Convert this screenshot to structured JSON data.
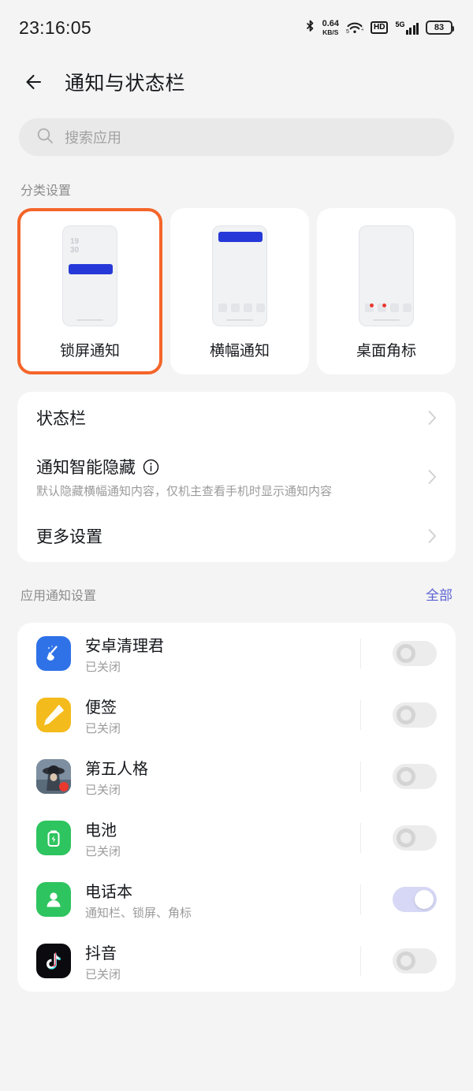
{
  "statusbar": {
    "clock": "23:16:05",
    "bluetooth_icon": "bluetooth-icon",
    "netspeed_value": "0.64",
    "netspeed_unit": "KB/S",
    "wifi_icon": "wifi-icon",
    "hd_label": "HD",
    "network_label": "5G",
    "signal_icon": "signal-bars-icon",
    "battery_level": "83"
  },
  "header": {
    "back_icon": "back-arrow-icon",
    "title": "通知与状态栏"
  },
  "search": {
    "icon": "search-icon",
    "placeholder": "搜索应用"
  },
  "category": {
    "label": "分类设置",
    "selected_color": "#f4652a",
    "cards": [
      {
        "label": "锁屏通知",
        "preview": "lockscreen-preview",
        "time_line1": "19",
        "time_line2": "30",
        "selected": true
      },
      {
        "label": "横幅通知",
        "preview": "banner-preview",
        "selected": false
      },
      {
        "label": "桌面角标",
        "preview": "badge-preview",
        "selected": false
      }
    ]
  },
  "settings_group": {
    "rows": [
      {
        "title": "状态栏",
        "sub": "",
        "has_info": false,
        "chevron": "chevron-right-icon"
      },
      {
        "title": "通知智能隐藏",
        "sub": "默认隐藏横幅通知内容，仅机主查看手机时显示通知内容",
        "has_info": true,
        "info_icon": "info-circle-icon",
        "chevron": "chevron-right-icon"
      },
      {
        "title": "更多设置",
        "sub": "",
        "has_info": false,
        "chevron": "chevron-right-icon"
      }
    ]
  },
  "app_section": {
    "label": "应用通知设置",
    "all_label": "全部",
    "all_color": "#5b63d3",
    "apps": [
      {
        "name": "安卓清理君",
        "state": "已关闭",
        "icon": "broom-app-icon",
        "icon_color": "#2f72e8",
        "enabled": false
      },
      {
        "name": "便签",
        "state": "已关闭",
        "icon": "notes-app-icon",
        "icon_color": "#f4bb1c",
        "enabled": false
      },
      {
        "name": "第五人格",
        "state": "已关闭",
        "icon": "identityv-app-icon",
        "icon_color": "#5d6a78",
        "enabled": false
      },
      {
        "name": "电池",
        "state": "已关闭",
        "icon": "battery-app-icon",
        "icon_color": "#2ec45f",
        "enabled": false
      },
      {
        "name": "电话本",
        "state": "通知栏、锁屏、角标",
        "icon": "contacts-app-icon",
        "icon_color": "#2ec45f",
        "enabled": true
      },
      {
        "name": "抖音",
        "state": "已关闭",
        "icon": "douyin-app-icon",
        "icon_color": "#0b0b0f",
        "enabled": false
      }
    ]
  }
}
